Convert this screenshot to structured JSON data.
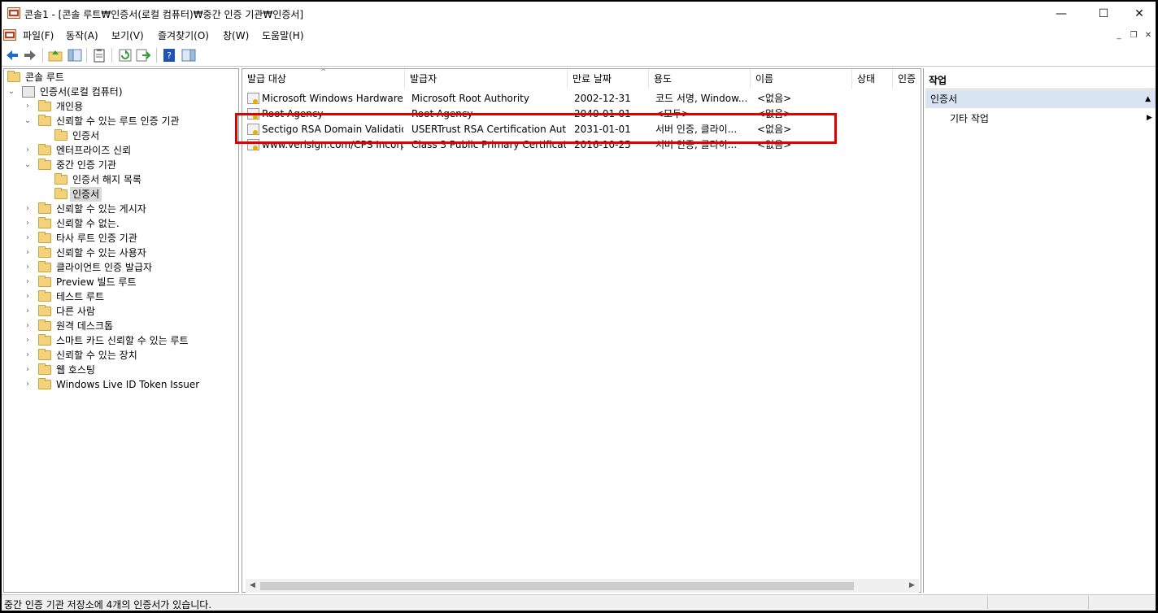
{
  "window": {
    "title": "콘솔1 - [콘솔 루트₩인증서(로컬 컴퓨터)₩중간 인증 기관₩인증서]",
    "minimize": "—",
    "maximize": "☐",
    "close": "✕"
  },
  "menu": {
    "items": [
      "파일(F)",
      "동작(A)",
      "보기(V)",
      "즐겨찾기(O)",
      "창(W)",
      "도움말(H)"
    ],
    "mdi": {
      "minimize": "_",
      "restore": "❐",
      "close": "✕"
    }
  },
  "toolbar": {
    "icons": [
      "back-arrow-icon",
      "forward-arrow-icon",
      "up-folder-icon",
      "show-hide-tree-icon",
      "clipboard-icon",
      "refresh-icon",
      "export-list-icon",
      "help-icon",
      "show-hide-action-pane-icon"
    ],
    "colors": {
      "back": "#1b6ec2",
      "forward": "#6a6a6a",
      "help": "#2153b3",
      "refresh": "#2ca02c"
    }
  },
  "tree": {
    "root": "콘솔 루트",
    "computer": "인증서(로컬 컴퓨터)",
    "nodes": [
      {
        "label": "개인용"
      },
      {
        "label": "신뢰할 수 있는 루트 인증 기관"
      },
      {
        "label": "인증서"
      },
      {
        "label": "엔터프라이즈 신뢰"
      },
      {
        "label": "중간 인증 기관"
      },
      {
        "label": "인증서 해지 목록"
      },
      {
        "label": "인증서",
        "selected": true
      },
      {
        "label": "신뢰할 수 있는 게시자"
      },
      {
        "label": "신뢰할 수 없는."
      },
      {
        "label": "타사 루트 인증 기관"
      },
      {
        "label": "신뢰할 수 있는 사용자"
      },
      {
        "label": "클라이언트 인증 발급자"
      },
      {
        "label": "Preview 빌드 루트"
      },
      {
        "label": "테스트 루트"
      },
      {
        "label": "다른 사람"
      },
      {
        "label": "원격 데스크톱"
      },
      {
        "label": "스마트 카드 신뢰할 수 있는 루트"
      },
      {
        "label": "신뢰할 수 있는 장치"
      },
      {
        "label": "웹 호스팅"
      },
      {
        "label": "Windows Live ID Token Issuer"
      }
    ]
  },
  "list": {
    "columns": [
      "발급 대상",
      "발급자",
      "만료 날짜",
      "용도",
      "이름",
      "상태",
      "인증"
    ],
    "rows": [
      {
        "subject": "Microsoft Windows Hardware ...",
        "issuer": "Microsoft Root Authority",
        "expires": "2002-12-31",
        "purpose": "코드 서명, Window...",
        "name": "<없음>"
      },
      {
        "subject": "Root Agency",
        "issuer": "Root Agency",
        "expires": "2040-01-01",
        "purpose": "<모두>",
        "name": "<없음>"
      },
      {
        "subject": "Sectigo RSA Domain Validatio...",
        "issuer": "USERTrust RSA Certification Auth...",
        "expires": "2031-01-01",
        "purpose": "서버 인증, 클라이...",
        "name": "<없음>"
      },
      {
        "subject": "www.verisign.com/CPS Incorp...",
        "issuer": "Class 3 Public Primary Certificati...",
        "expires": "2016-10-25",
        "purpose": "서버 인증, 클라이...",
        "name": "<없음>"
      }
    ],
    "highlight_color": "#e00000"
  },
  "actions": {
    "header": "작업",
    "group": "인증서",
    "item": "기타 작업"
  },
  "status": {
    "text": "중간 인증 기관 저장소에 4개의 인증서가 있습니다."
  }
}
